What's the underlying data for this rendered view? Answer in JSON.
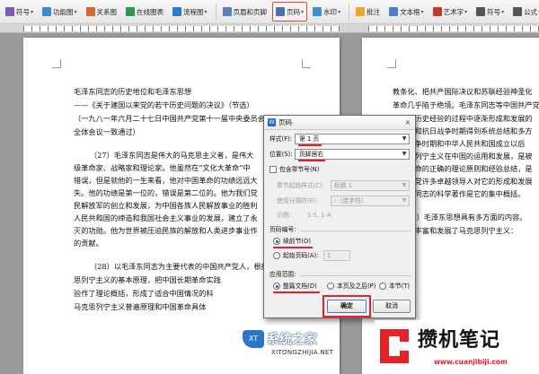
{
  "toolbar": {
    "items": [
      {
        "label": "符号",
        "icon": "symbol-icon",
        "color": "#7a5ab8",
        "caret": true
      },
      {
        "label": "功能图",
        "icon": "function-chart-icon",
        "color": "#3b8ad8",
        "caret": true
      },
      {
        "label": "关系图",
        "icon": "relation-chart-icon",
        "color": "#d9682a",
        "caret": false
      },
      {
        "label": "在线图表",
        "icon": "online-chart-icon",
        "color": "#2a9a4a",
        "caret": false
      },
      {
        "label": "流程图",
        "icon": "flowchart-icon",
        "color": "#2b79d0",
        "caret": true
      },
      {
        "label": "页眉和页脚",
        "icon": "header-footer-icon",
        "color": "#5a7fbf",
        "caret": false
      },
      {
        "label": "页码",
        "icon": "page-number-icon",
        "color": "#4a6fb5",
        "caret": true,
        "active": true
      },
      {
        "label": "水印",
        "icon": "watermark-icon",
        "color": "#3f8fcf",
        "caret": true
      },
      {
        "label": "批注",
        "icon": "comment-icon",
        "color": "#e7a82c",
        "caret": false
      },
      {
        "label": "文本框",
        "icon": "textbox-icon",
        "color": "#4b7fc9",
        "caret": true
      },
      {
        "label": "艺术字",
        "icon": "wordart-icon",
        "color": "#c0392b",
        "caret": true
      },
      {
        "label": "符号",
        "icon": "omega-icon",
        "color": "#555555",
        "caret": true
      },
      {
        "label": "公式",
        "icon": "formula-icon",
        "color": "#555555",
        "caret": true
      },
      {
        "label": "首字下沉",
        "icon": "drop-cap-icon",
        "color": "#777777",
        "caret": false
      },
      {
        "label": "编辑对象",
        "icon": "edit-object-icon",
        "color": "#2a7fd0",
        "caret": false
      },
      {
        "label": "文档部件",
        "icon": "doc-parts-icon",
        "color": "#3a8a4a",
        "caret": true
      }
    ]
  },
  "document": {
    "left_lines": [
      "毛泽东同志的历史地位和毛泽东思想",
      "——《关于建国以来党的若干历史问题的决议》（节选）",
      "（一九八一年六月二十七日中国共产党第十一届中央委员会",
      "全体会议一致通过）",
      "（27）毛泽东同志是伟大的马克思主义者，是伟大",
      "级革命家、战略家和理论家。他虽然在“文化大革命”中",
      "错误，但是就他的一生来看，他对中国革命的功绩远远大",
      "失。他的功绩是第一位的，错误是第二位的。他为我们党",
      "民解放军的创立和发展，为中国各族人民解放事业的胜利",
      "人民共和国的缔造和我国社会主义事业的发展，建立了永",
      "灭的功勋。他为世界被压迫民族的解放和人类进步事业作",
      "的贡献。",
      "（28）以毛泽东同志为主要代表的中国共产党人，根据",
      "思列宁主义的基本原理，把中国长期革命实践",
      "验作了理论概括，形成了适合中国情况的科",
      "马克思列宁主义普遍原理和中国革命具体"
    ],
    "right_lines": [
      "教条化、把共产国际决议和苏联经验神圣化",
      "革命几乎陷于绝境。毛泽东同志等中国共产党",
      "方面的历史经验的过程中逐渐形成和发展的",
      "争后期和抗日战争时期得到系统总结和多方",
      "解放战争时期和中华人民共和国成立以后",
      "马克思列宁主义在中国的运用和发展，是被",
      "中国革命的正确的理论原则和经验总结，是",
      "晶。我党许多卓越领导人对它的形成和发展",
      "毛泽东同志的科学著作是它的集中概括。",
      "（29）毛泽东思想具有多方面的内容。",
      "性理论丰富和发展了马克思列宁主义："
    ]
  },
  "dialog": {
    "title": "页码",
    "close_glyph": "×",
    "style_label": "样式(F):",
    "style_value": "第 1 页",
    "position_label": "位置(S):",
    "position_value": "页脚居右",
    "include_chapter_label": "包含章节号(N)",
    "chapter_start_style_label": "章节起始样式(C):",
    "chapter_start_style_value": "标题 1",
    "separator_label": "使用分隔符(E):",
    "separator_value": "-（连字符）",
    "example_label": "示例:",
    "example_value": "1-1, 1-A",
    "numbering_group_label": "页码编号:",
    "continue_prev_label": "续前节(O)",
    "start_at_label": "起始页码(A):",
    "start_at_value": "1",
    "apply_group_label": "应用范围:",
    "apply_whole_label": "整篇文档(D)",
    "apply_after_label": "本页及之后(P)",
    "apply_section_label": "本节(T)",
    "ok_label": "确定",
    "cancel_label": "取消"
  },
  "watermarks": {
    "xitongzhijia_logo": "XT",
    "xitongzhijia_name": "系统之家",
    "xitongzhijia_url": "XITONGZHIJIA.NET",
    "cuanjibiji_name": "攒机笔记",
    "cuanjibiji_url": "www.cuanjibiji.com"
  },
  "colors": {
    "annotation_red": "#e8202a",
    "dialog_accent": "#1f6fd1"
  }
}
